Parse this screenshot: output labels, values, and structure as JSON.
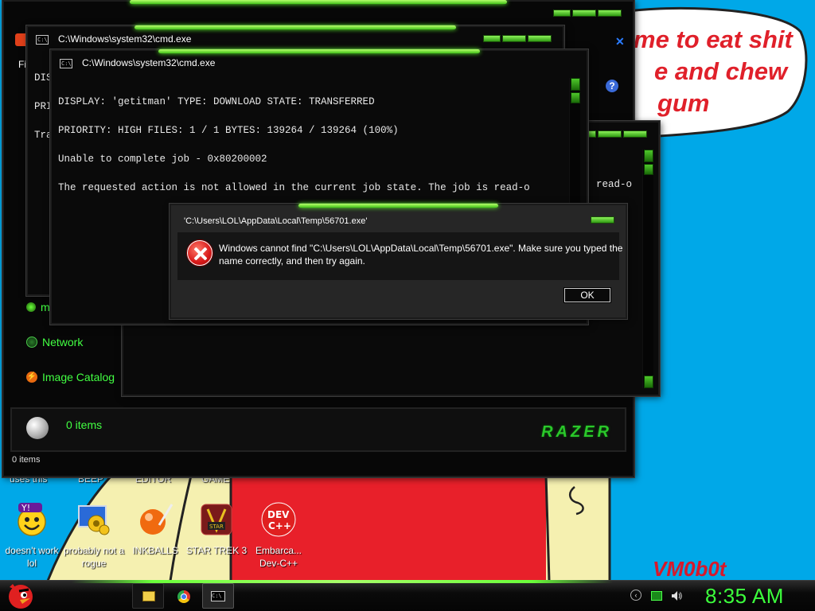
{
  "wallpaper": {
    "speech_lines": [
      "me to eat shit",
      "e and chew",
      "gum"
    ],
    "signature": "VM0b0t"
  },
  "desktop": {
    "cut_labels": [
      "uses this",
      "BEEP",
      "EDITOR",
      "GAME"
    ],
    "icons": [
      {
        "label": "doesn't work lol",
        "icon": "yahoo-messenger-icon"
      },
      {
        "label": "probably not a rogue",
        "icon": "gears-monitor-icon"
      },
      {
        "label": "INKBALLS",
        "icon": "inkball-icon"
      },
      {
        "label": "STAR TREK 3",
        "icon": "star-trek-icon"
      },
      {
        "label": "Embarca... Dev-C++",
        "icon": "dev-cpp-icon"
      }
    ]
  },
  "explorer": {
    "tab_label": "Fi",
    "nav": [
      {
        "label": "m",
        "icon": "green-bullet-icon"
      },
      {
        "label": "Network",
        "icon": "network-icon"
      },
      {
        "label": "Image Catalog",
        "icon": "image-catalog-icon"
      }
    ],
    "items_label": "0 items",
    "status_label": "0 items",
    "brand": "RAZER"
  },
  "cmd_back": {
    "title": "C:\\Windows\\system32\\cmd.exe",
    "peek_lines": [
      "DIS",
      "PRI",
      "Tra"
    ]
  },
  "cmd_right": {
    "peek_text": "read-o"
  },
  "cmd_front": {
    "title": "C:\\Windows\\system32\\cmd.exe",
    "lines": [
      "DISPLAY: 'getitman' TYPE: DOWNLOAD STATE: TRANSFERRED",
      "PRIORITY: HIGH FILES: 1 / 1 BYTES: 139264 / 139264 (100%)",
      "Unable to complete job - 0x80200002",
      "The requested action is not allowed in the current job state. The job is read-o"
    ]
  },
  "dialog": {
    "title": "'C:\\Users\\LOL\\AppData\\Local\\Temp\\56701.exe'",
    "message": "Windows cannot find \"C:\\Users\\LOL\\AppData\\Local\\Temp\\56701.exe\". Make sure you typed the name correctly, and then try again.",
    "ok_label": "OK"
  },
  "taskbar": {
    "clock": "8:35 AM",
    "buttons": [
      "file-explorer-icon",
      "chrome-icon",
      "cmd-icon"
    ],
    "tray": [
      "back-arrow-icon",
      "network-status-icon",
      "volume-icon"
    ]
  },
  "colors": {
    "accent_green": "#42ff42",
    "razer_glow": "#6aff3a",
    "desktop_blue": "#00a8e8",
    "error_red": "#d81a1a"
  }
}
